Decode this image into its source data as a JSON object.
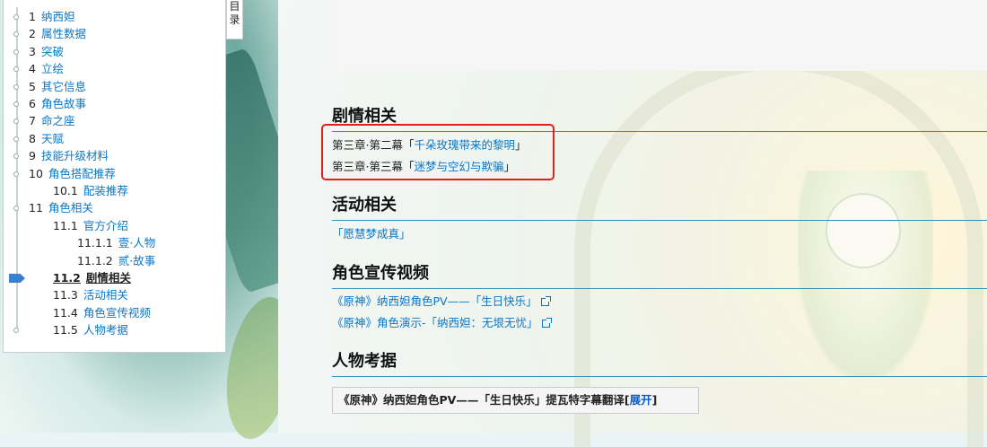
{
  "toc": {
    "tab_chars": [
      "目",
      "录"
    ],
    "items": [
      {
        "num": "1",
        "text": "纳西妲",
        "level": 1
      },
      {
        "num": "2",
        "text": "属性数据",
        "level": 1
      },
      {
        "num": "3",
        "text": "突破",
        "level": 1
      },
      {
        "num": "4",
        "text": "立绘",
        "level": 1
      },
      {
        "num": "5",
        "text": "其它信息",
        "level": 1
      },
      {
        "num": "6",
        "text": "角色故事",
        "level": 1
      },
      {
        "num": "7",
        "text": "命之座",
        "level": 1
      },
      {
        "num": "8",
        "text": "天赋",
        "level": 1
      },
      {
        "num": "9",
        "text": "技能升级材料",
        "level": 1
      },
      {
        "num": "10",
        "text": "角色搭配推荐",
        "level": 1
      },
      {
        "num": "10.1",
        "text": "配装推荐",
        "level": 2
      },
      {
        "num": "11",
        "text": "角色相关",
        "level": 1
      },
      {
        "num": "11.1",
        "text": "官方介绍",
        "level": 2
      },
      {
        "num": "11.1.1",
        "text": "壹·人物",
        "level": 3
      },
      {
        "num": "11.1.2",
        "text": "贰·故事",
        "level": 3
      },
      {
        "num": "11.2",
        "text": "剧情相关",
        "level": 2,
        "active": true
      },
      {
        "num": "11.3",
        "text": "活动相关",
        "level": 2
      },
      {
        "num": "11.4",
        "text": "角色宣传视频",
        "level": 2
      },
      {
        "num": "11.5",
        "text": "人物考据",
        "level": 2
      }
    ]
  },
  "sections": {
    "story": {
      "heading": "剧情相关",
      "lines": [
        {
          "prefix": "第三章·第二幕「",
          "link": "千朵玫瑰带来的黎明",
          "suffix": "」"
        },
        {
          "prefix": "第三章·第三幕「",
          "link": "迷梦与空幻与欺骗",
          "suffix": "」"
        }
      ]
    },
    "events": {
      "heading": "活动相关",
      "link": "「愿慧梦成真」"
    },
    "videos": {
      "heading": "角色宣传视频",
      "links": [
        "《原神》纳西妲角色PV——「生日快乐」",
        "《原神》角色演示-「纳西妲：无垠无忧」"
      ]
    },
    "research": {
      "heading": "人物考据",
      "collapse_title": "《原神》纳西妲角色PV——「生日快乐」提瓦特字幕翻译",
      "toggle_open": "[",
      "toggle_label": "展开",
      "toggle_close": "]"
    }
  },
  "colors": {
    "link": "#0b76c8",
    "heading_rule": "#3a8fb0",
    "highlight": "#e0201b",
    "toc_marker": "#3a7fd0"
  },
  "icons": [
    "external-link-icon",
    "toc-current-marker-icon"
  ]
}
